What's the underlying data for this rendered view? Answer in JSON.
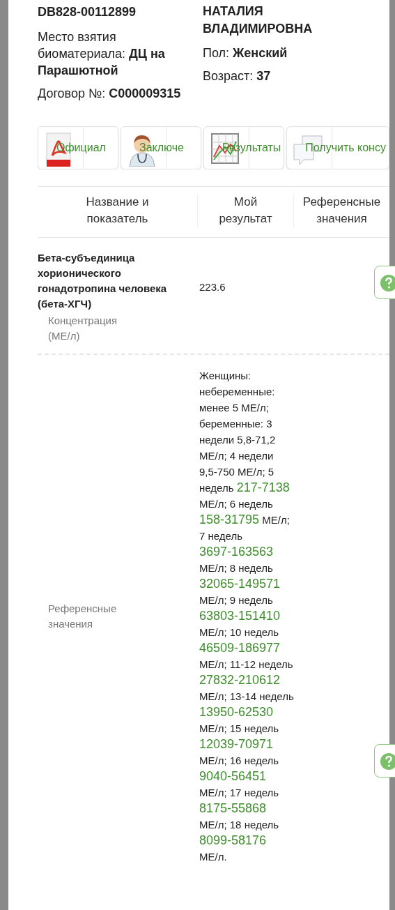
{
  "sample_id": "DB828-00112899",
  "patient_name": "НАТАЛИЯ ВЛАДИМИРОВНА",
  "fields_left": [
    {
      "label": "Место взятия биоматериала:",
      "value": "ДЦ на Парашютной"
    },
    {
      "label": "Договор №:",
      "value": "С000009315"
    }
  ],
  "fields_right": [
    {
      "label": "Пол:",
      "value": "Женский"
    },
    {
      "label": "Возраст:",
      "value": "37"
    }
  ],
  "actions": [
    {
      "kind": "pdf",
      "label": "Официал"
    },
    {
      "kind": "doctor",
      "label": "Заключе"
    },
    {
      "kind": "chart",
      "label": "Результаты"
    },
    {
      "kind": "chat",
      "label": "Получить консу"
    }
  ],
  "table": {
    "columns": [
      "Название и показатель",
      "Мой результат",
      "Референсные значения"
    ],
    "rows": [
      {
        "kind": "result",
        "name": "Бета-субъединица хорионического гонадотропина человека (бета-ХГЧ)",
        "sublabel": "Концентрация (МЕ/л)",
        "value": "223.6"
      },
      {
        "kind": "reference",
        "label": "Референсные значения",
        "segments": [
          {
            "kind": "plain",
            "text": "Женщины: небеременные: менее 5 МЕ/л; беременные: 3 недели 5,8-71,2 МЕ/л; 4 недели 9,5-750 МЕ/л; 5 недель"
          },
          {
            "kind": "range",
            "text": "217-7138"
          },
          {
            "kind": "plain",
            "text": "МЕ/л; 6 недель"
          },
          {
            "kind": "range",
            "text": "158-31795"
          },
          {
            "kind": "plain",
            "text": "МЕ/л; 7 недель"
          },
          {
            "kind": "range",
            "text": "3697-163563"
          },
          {
            "kind": "plain",
            "text": "МЕ/л; 8 недель"
          },
          {
            "kind": "range",
            "text": "32065-149571"
          },
          {
            "kind": "plain",
            "text": "МЕ/л; 9 недель"
          },
          {
            "kind": "range",
            "text": "63803-151410"
          },
          {
            "kind": "plain",
            "text": "МЕ/л; 10 недель"
          },
          {
            "kind": "range",
            "text": "46509-186977"
          },
          {
            "kind": "plain",
            "text": "МЕ/л; 11-12 недель"
          },
          {
            "kind": "range",
            "text": "27832-210612"
          },
          {
            "kind": "plain",
            "text": "МЕ/л; 13-14 недель"
          },
          {
            "kind": "range",
            "text": "13950-62530"
          },
          {
            "kind": "plain",
            "text": "МЕ/л; 15 недель"
          },
          {
            "kind": "range",
            "text": "12039-70971"
          },
          {
            "kind": "plain",
            "text": "МЕ/л; 16 недель"
          },
          {
            "kind": "range",
            "text": "9040-56451"
          },
          {
            "kind": "plain",
            "text": "МЕ/л; 17 недель"
          },
          {
            "kind": "range",
            "text": "8175-55868"
          },
          {
            "kind": "plain",
            "text": "МЕ/л; 18 недель"
          },
          {
            "kind": "range",
            "text": "8099-58176"
          },
          {
            "kind": "plain",
            "text": "МЕ/л."
          }
        ]
      }
    ]
  }
}
